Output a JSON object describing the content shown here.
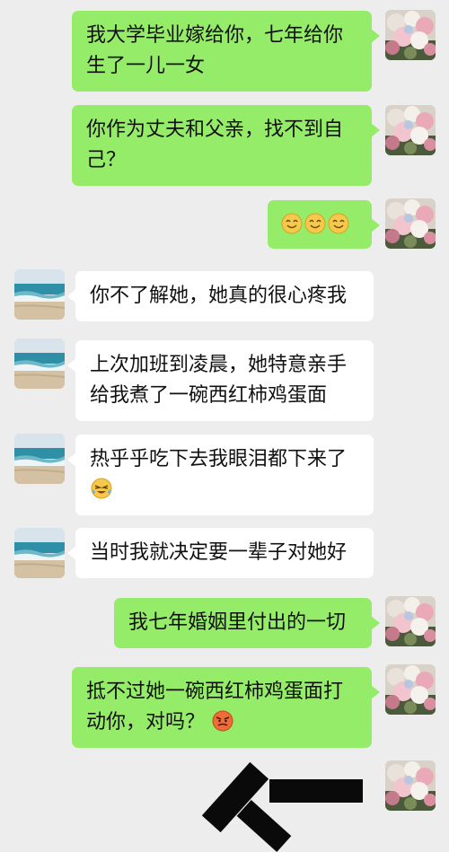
{
  "messages": [
    {
      "text": "我大学毕业嫁给你，七年给你生了一儿一女",
      "side": "out"
    },
    {
      "text": "你作为丈夫和父亲，找不到自己？",
      "side": "out"
    },
    {
      "text": "",
      "side": "out",
      "emojis": [
        "smile-emoji",
        "smile-emoji",
        "smile-emoji"
      ]
    },
    {
      "text": "你不了解她，她真的很心疼我",
      "side": "in"
    },
    {
      "text": "上次加班到凌晨，她特意亲手给我煮了一碗西红柿鸡蛋面",
      "side": "in"
    },
    {
      "text": "热乎乎吃下去我眼泪都下来了",
      "side": "in",
      "emojis": [
        "crying-laugh-emoji"
      ]
    },
    {
      "text": "当时我就决定要一辈子对她好",
      "side": "in"
    },
    {
      "text": "我七年婚姻里付出的一切",
      "side": "out"
    },
    {
      "text": "抵不过她一碗西红柿鸡蛋面打动你，对吗？",
      "side": "out",
      "emojis": [
        "angry-emoji"
      ]
    }
  ],
  "colors": {
    "background": "#ededed",
    "outgoing_bubble": "#95ec69",
    "incoming_bubble": "#ffffff",
    "redaction": "#0a0a0a"
  },
  "avatars": {
    "self": "flower-bouquet-avatar",
    "other": "beach-sea-avatar"
  }
}
